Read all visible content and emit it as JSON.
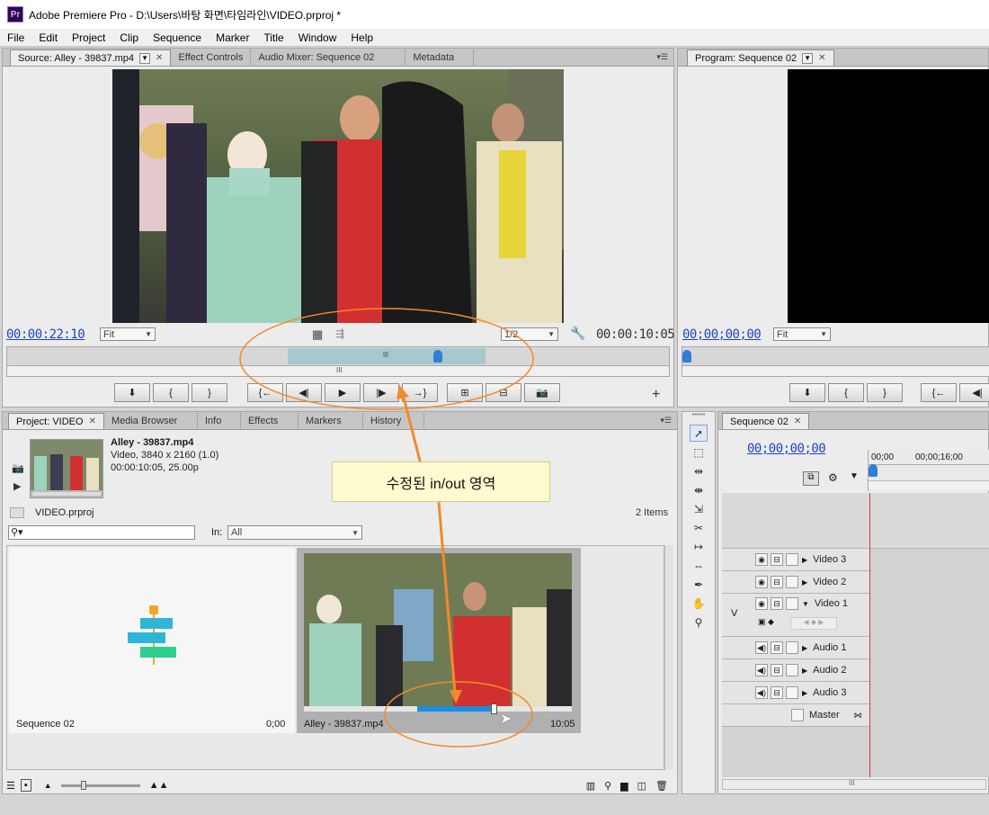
{
  "window": {
    "title": "Adobe Premiere Pro - D:\\Users\\바탕 화면\\타임라인\\VIDEO.prproj *",
    "app_icon": "Pr"
  },
  "menu": [
    "File",
    "Edit",
    "Project",
    "Clip",
    "Sequence",
    "Marker",
    "Title",
    "Window",
    "Help"
  ],
  "source_panel": {
    "tabs": [
      "Source: Alley - 39837.mp4",
      "Effect Controls",
      "Audio Mixer: Sequence 02",
      "Metadata"
    ],
    "timecode_in": "00:00:22:10",
    "fit": "Fit",
    "resolution": "1/2",
    "duration": "00:00:10:05"
  },
  "program_panel": {
    "tab": "Program: Sequence 02",
    "timecode": "00;00;00;00",
    "fit": "Fit"
  },
  "project_panel": {
    "tabs": [
      "Project: VIDEO",
      "Media Browser",
      "Info",
      "Effects",
      "Markers",
      "History"
    ],
    "clip_name": "Alley - 39837.mp4",
    "clip_info1": "Video, 3840 x 2160 (1.0)",
    "clip_info2": "00:00:10:05, 25.00p",
    "project_file": "VIDEO.prproj",
    "items_count": "2 Items",
    "in_label": "In:",
    "in_value": "All",
    "sequence_name": "Sequence 02",
    "sequence_duration": "0;00",
    "clip_thumb_name": "Alley - 39837.mp4",
    "clip_thumb_duration": "10:05"
  },
  "timeline_panel": {
    "tab": "Sequence 02",
    "timecode": "00;00;00;00",
    "ruler_start": "00;00",
    "ruler_mid": "00;00;16;00",
    "v_label": "V",
    "tracks": {
      "video3": "Video 3",
      "video2": "Video 2",
      "video1": "Video 1",
      "audio1": "Audio 1",
      "audio2": "Audio 2",
      "audio3": "Audio 3",
      "master": "Master"
    }
  },
  "annotation": {
    "text": "수정된 in/out 영역",
    "color": "#f28a2a"
  },
  "colors": {
    "timecode_blue": "#1f44c8",
    "inout_region": "#a8c8cf",
    "playhead": "#2f7fd6",
    "timeline_playhead": "#d83a3a",
    "progress_blue": "#1a8fe0"
  }
}
